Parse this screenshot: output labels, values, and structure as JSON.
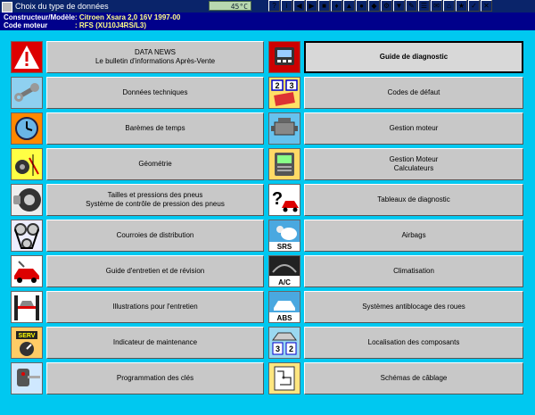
{
  "window": {
    "title": "Choix du type de données"
  },
  "lcd": {
    "value": "45°C"
  },
  "toolbar": {
    "icons": [
      "?",
      "i",
      "◀",
      "▶",
      "■",
      "♦",
      "▲",
      "●",
      "◆",
      "⚙",
      "▼",
      "✎",
      "☰",
      "✉",
      "⌂",
      "★",
      "✓",
      "✕"
    ]
  },
  "header": {
    "constructeur_label": "Constructeur/Modèle",
    "constructeur_value": ": Citroen  Xsara  2,0 16V 1997-00",
    "moteur_label": "Code moteur",
    "moteur_value": ": RFS (XU10J4RS/L3)"
  },
  "left_items": [
    {
      "lines": [
        "DATA NEWS",
        "Le bulletin d'informations Après-Vente"
      ],
      "icon": "warning-icon"
    },
    {
      "lines": [
        "Données techniques"
      ],
      "icon": "wrench-icon"
    },
    {
      "lines": [
        "Barèmes de temps"
      ],
      "icon": "clock-icon"
    },
    {
      "lines": [
        "Géométrie"
      ],
      "icon": "wheel-alignment-icon"
    },
    {
      "lines": [
        "Tailles et pressions des pneus",
        "Système de contrôle de pression des pneus"
      ],
      "icon": "tire-icon"
    },
    {
      "lines": [
        "Courroies de distribution"
      ],
      "icon": "timing-belt-icon"
    },
    {
      "lines": [
        "Guide d'entretien et de révision"
      ],
      "icon": "service-car-icon"
    },
    {
      "lines": [
        "Illustrations pour l'entretien"
      ],
      "icon": "car-lift-icon"
    },
    {
      "lines": [
        "Indicateur de maintenance"
      ],
      "icon": "service-indicator-icon"
    },
    {
      "lines": [
        "Programmation des clés"
      ],
      "icon": "key-icon"
    }
  ],
  "right_items": [
    {
      "lines": [
        "Guide de diagnostic"
      ],
      "icon": "diagnostic-tool-icon",
      "active": true
    },
    {
      "lines": [
        "Codes de défaut"
      ],
      "icon": "fault-codes-icon"
    },
    {
      "lines": [
        "Gestion moteur"
      ],
      "icon": "engine-icon"
    },
    {
      "lines": [
        "Gestion Moteur",
        "Calculateurs"
      ],
      "icon": "ecu-icon"
    },
    {
      "lines": [
        "Tableaux de diagnostic"
      ],
      "icon": "question-car-icon"
    },
    {
      "lines": [
        "Airbags"
      ],
      "icon": "airbag-icon"
    },
    {
      "lines": [
        "Climatisation"
      ],
      "icon": "ac-icon"
    },
    {
      "lines": [
        "Systèmes antiblocage des roues"
      ],
      "icon": "abs-icon"
    },
    {
      "lines": [
        "Localisation des composants"
      ],
      "icon": "component-location-icon"
    },
    {
      "lines": [
        "Schémas de câblage"
      ],
      "icon": "wiring-diagram-icon"
    }
  ],
  "icon_texts": {
    "srs": "SRS",
    "ac": "A/C",
    "abs": "ABS",
    "serv": "SERV",
    "n1": "2",
    "n2": "3",
    "n3": "3",
    "n4": "2"
  },
  "colors": {
    "header_bg": "#00008b",
    "panel_bg": "#00c8f0",
    "title_bg": "#0a246a"
  }
}
